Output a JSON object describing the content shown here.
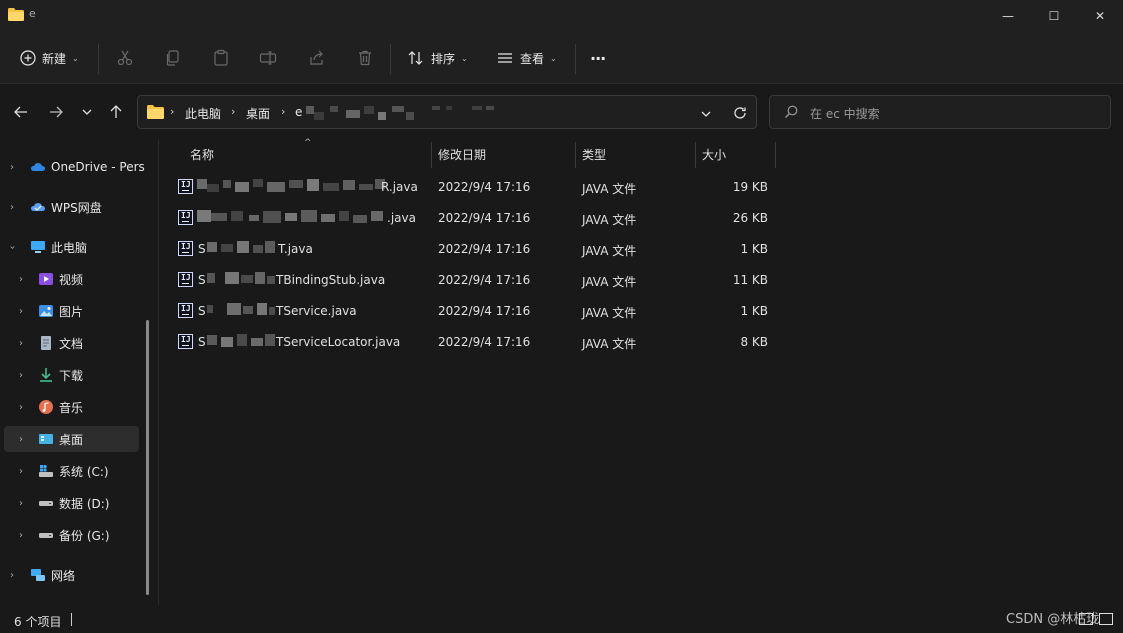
{
  "window": {
    "tab_title": "e",
    "min_glyph": "—",
    "max_glyph": "☐",
    "close_glyph": "✕"
  },
  "toolbar": {
    "new_label": "新建",
    "sort_label": "排序",
    "view_label": "查看",
    "more_label": "···"
  },
  "address": {
    "crumbs": [
      "此电脑",
      "桌面",
      "e"
    ],
    "search_placeholder": "在 ec 中搜索"
  },
  "sidebar": {
    "items": [
      {
        "label": "OneDrive - Pers",
        "icon": "cloud-icon"
      },
      {
        "label": "WPS网盘",
        "icon": "wps-cloud-icon"
      },
      {
        "label": "此电脑",
        "icon": "computer-icon"
      },
      {
        "label": "视频",
        "icon": "video-icon"
      },
      {
        "label": "图片",
        "icon": "pictures-icon"
      },
      {
        "label": "文档",
        "icon": "documents-icon"
      },
      {
        "label": "下载",
        "icon": "download-icon"
      },
      {
        "label": "音乐",
        "icon": "music-icon"
      },
      {
        "label": "桌面",
        "icon": "desktop-icon"
      },
      {
        "label": "系统 (C:)",
        "icon": "drive-c-icon"
      },
      {
        "label": "数据 (D:)",
        "icon": "drive-icon"
      },
      {
        "label": "备份 (G:)",
        "icon": "drive-icon"
      },
      {
        "label": "网络",
        "icon": "network-icon"
      }
    ]
  },
  "columns": {
    "name": "名称",
    "modified": "修改日期",
    "type": "类型",
    "size": "大小"
  },
  "files": [
    {
      "name": "R.java",
      "modified": "2022/9/4 17:16",
      "type": "JAVA 文件",
      "size": "19 KB"
    },
    {
      "name": ".java",
      "modified": "2022/9/4 17:16",
      "type": "JAVA 文件",
      "size": "26 KB"
    },
    {
      "name": "T.java",
      "modified": "2022/9/4 17:16",
      "type": "JAVA 文件",
      "size": "1 KB"
    },
    {
      "name": "TBindingStub.java",
      "modified": "2022/9/4 17:16",
      "type": "JAVA 文件",
      "size": "11 KB"
    },
    {
      "name": "TService.java",
      "modified": "2022/9/4 17:16",
      "type": "JAVA 文件",
      "size": "1 KB"
    },
    {
      "name": "TServiceLocator.java",
      "modified": "2022/9/4 17:16",
      "type": "JAVA 文件",
      "size": "8 KB"
    }
  ],
  "file_prefix": "S",
  "status": {
    "count": "6 个项目",
    "watermark": "CSDN @林枯珑"
  },
  "colors": {
    "accent_folder": "#f5c242",
    "selected_bg": "#2d2d2d"
  }
}
